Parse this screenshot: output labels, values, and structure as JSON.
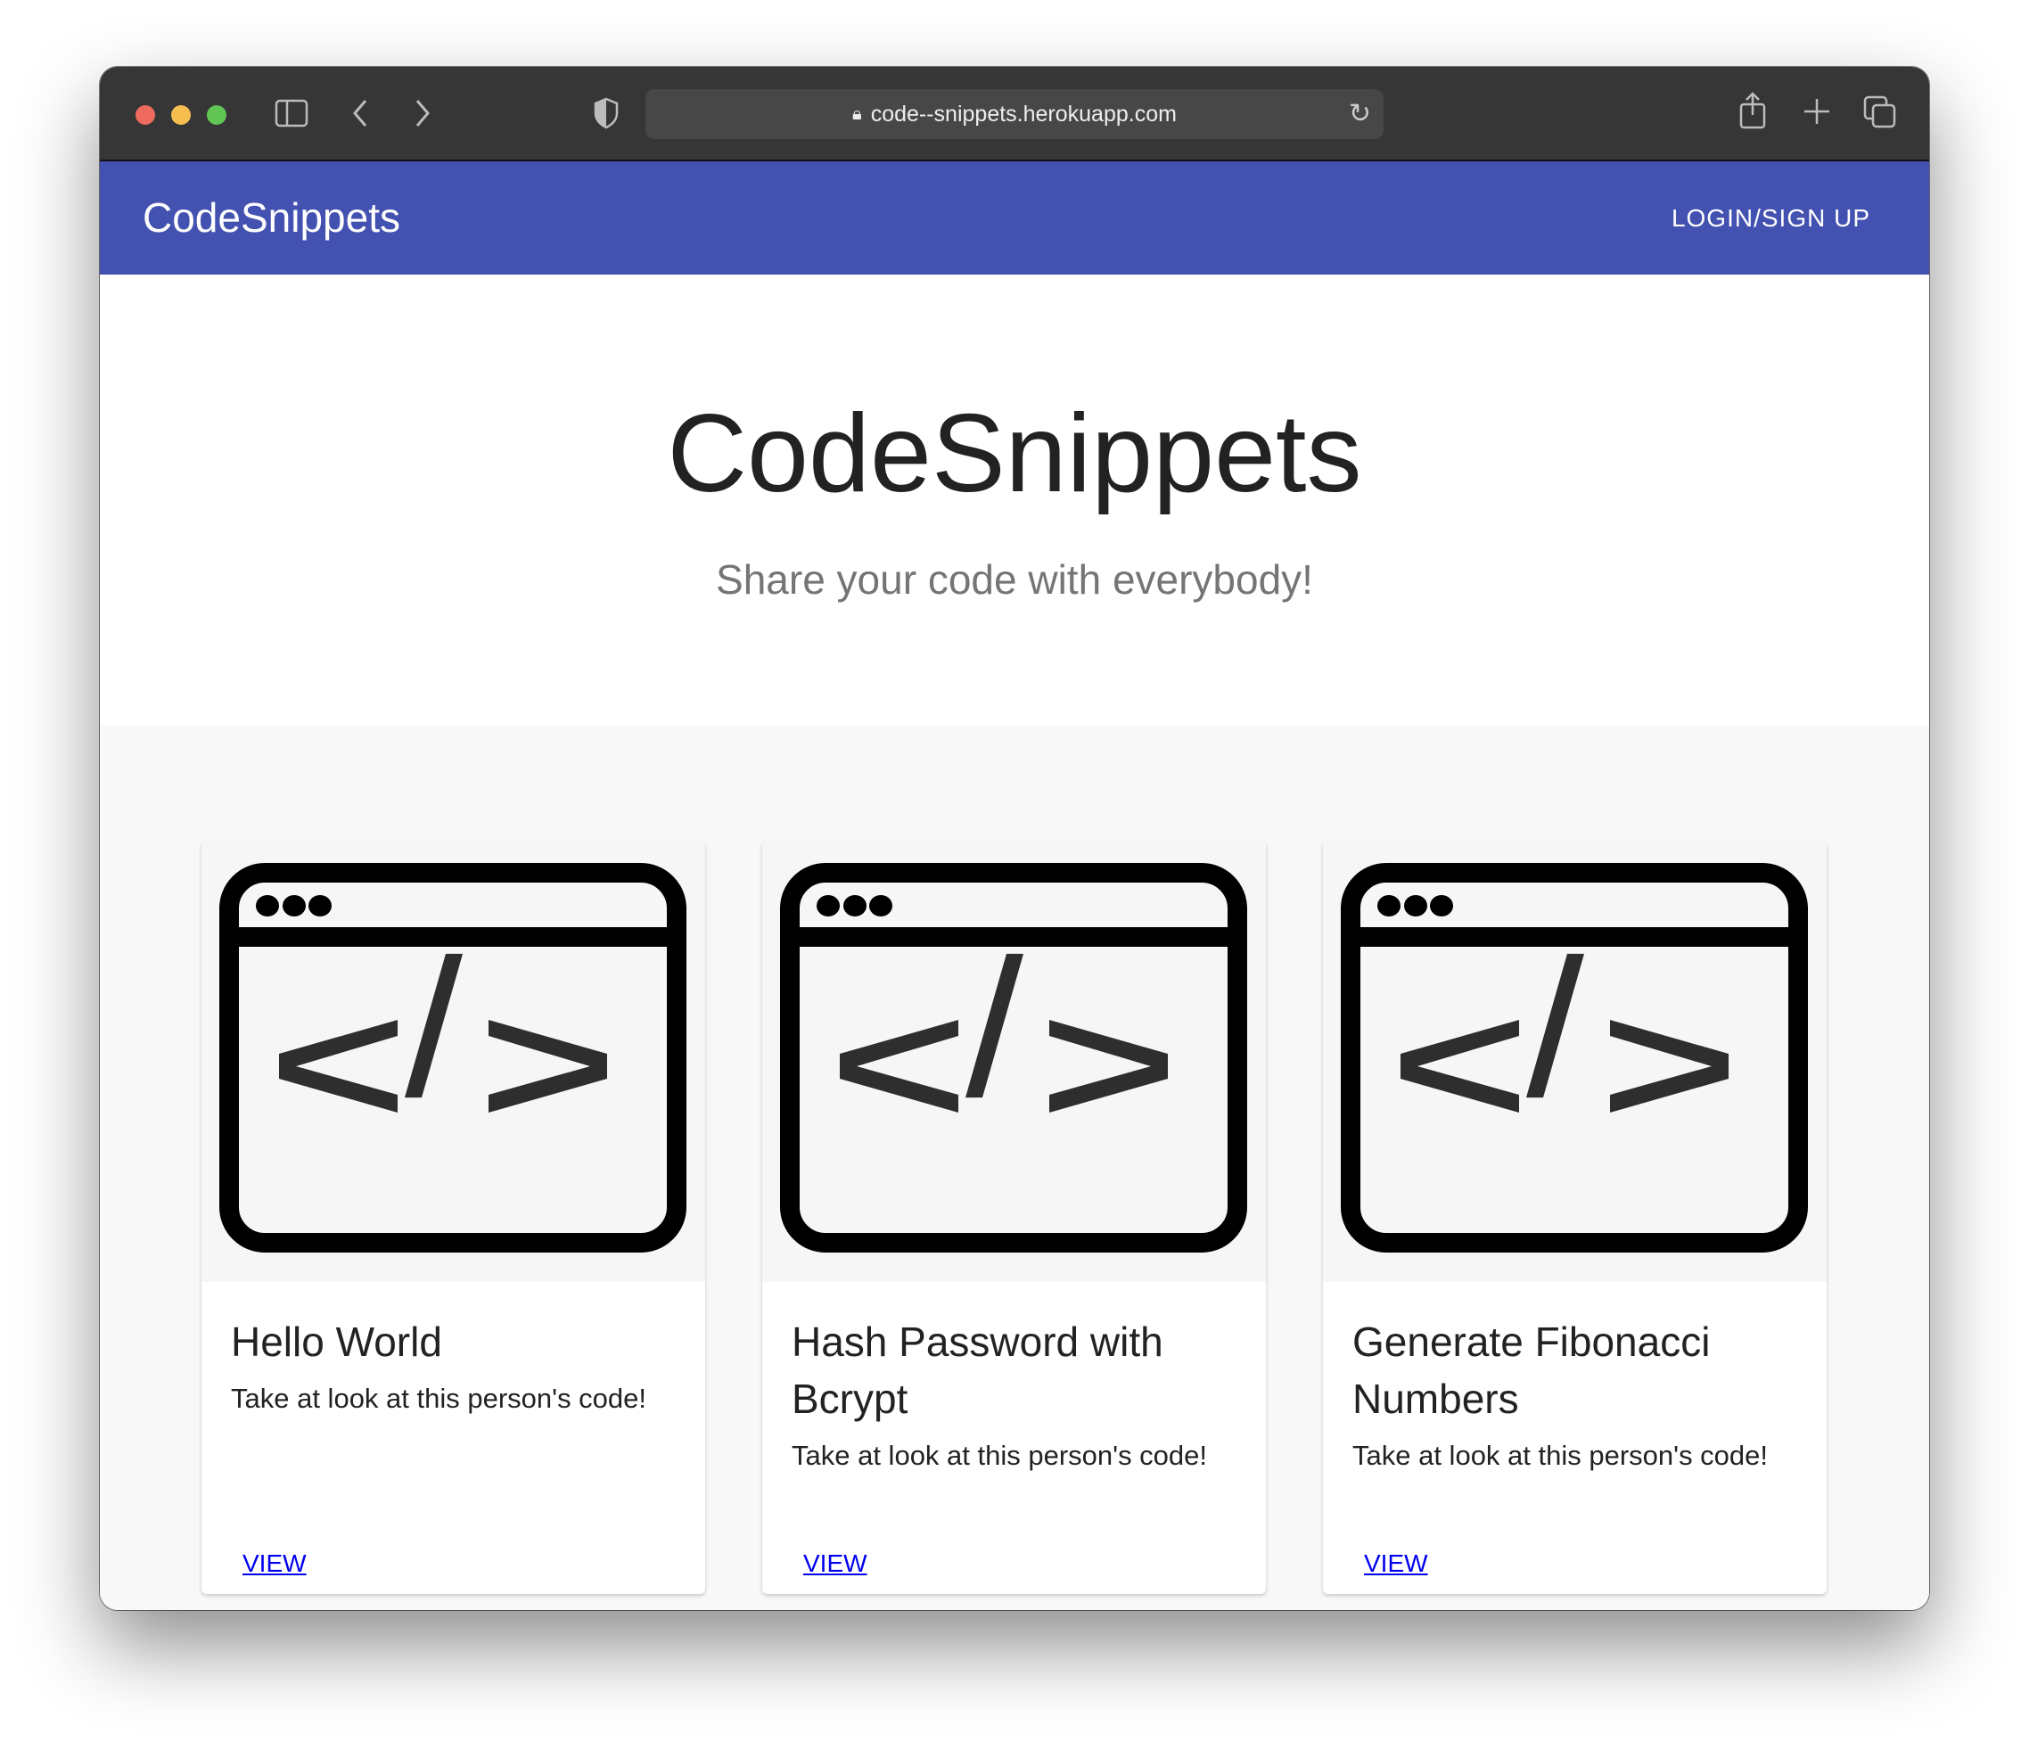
{
  "browser": {
    "url": "code--snippets.herokuapp.com",
    "traffic_colors": [
      "#ee6a5e",
      "#f5be4f",
      "#61c554"
    ]
  },
  "navbar": {
    "brand": "CodeSnippets",
    "login_label": "LOGIN/SIGN UP",
    "color": "#4351b0"
  },
  "hero": {
    "title": "CodeSnippets",
    "subtitle": "Share your code with everybody!"
  },
  "cards": [
    {
      "title": "Hello World",
      "description": "Take at look at this person's code!",
      "link": "VIEW",
      "icon": "code-window-icon"
    },
    {
      "title": "Hash Password with Bcrypt",
      "description": "Take at look at this person's code!",
      "link": "VIEW",
      "icon": "code-window-icon"
    },
    {
      "title": "Generate Fibonacci Numbers",
      "description": "Take at look at this person's code!",
      "link": "VIEW",
      "icon": "code-window-icon"
    }
  ]
}
